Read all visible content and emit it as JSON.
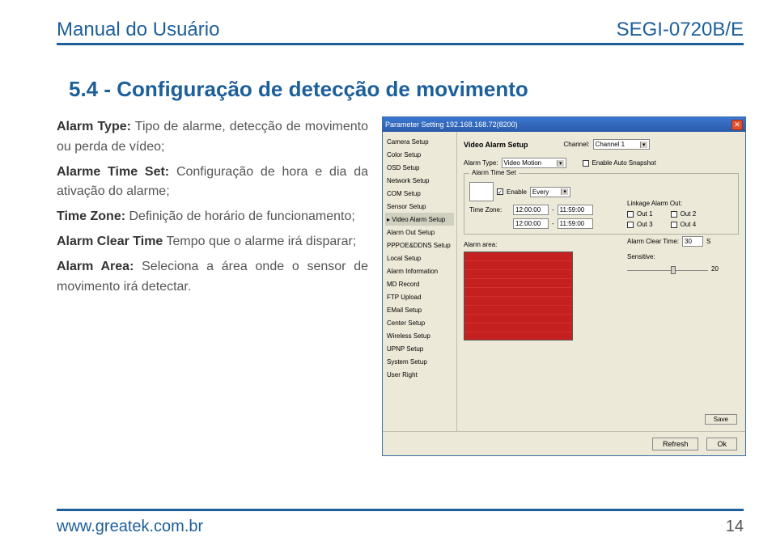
{
  "header": {
    "left": "Manual do Usuário",
    "right": "SEGI-0720B/E"
  },
  "section_title": "5.4 - Configuração de detecção de movimento",
  "paragraphs": {
    "p1_b": "Alarm Type:",
    "p1": " Tipo de alarme, detecção de movimento ou perda de vídeo;",
    "p2_b": "Alarme Time Set:",
    "p2": " Configuração de hora e dia da ativação do alarme;",
    "p3_b": "Time Zone:",
    "p3": " Definição de horário de funcionamento;",
    "p4_b": "Alarm Clear Time",
    "p4": " Tempo que o alarme irá disparar;",
    "p5_b": "Alarm Area:",
    "p5": " Seleciona a área onde o sensor de movimento irá detectar."
  },
  "footer": {
    "left": "www.greatek.com.br",
    "right": "14"
  },
  "win": {
    "title": "Parameter Setting 192.168.168.72(8200)",
    "sidebar": [
      "Camera Setup",
      "Color Setup",
      "OSD Setup",
      "Network Setup",
      "COM Setup",
      "Sensor Setup",
      "Video Alarm Setup",
      "Alarm Out Setup",
      "PPPOE&DDNS Setup",
      "Local Setup",
      "Alarm Information",
      "MD Record",
      "FTP Upload",
      "EMail Setup",
      "Center Setup",
      "Wireless Setup",
      "UPNP Setup",
      "System Setup",
      "User Right"
    ],
    "sidebar_selected": 6,
    "main_title": "Video Alarm Setup",
    "channel_label": "Channel:",
    "channel_value": "Channel 1",
    "alarm_type_label": "Alarm Type:",
    "alarm_type_value": "Video Motion",
    "auto_snap_label": "Enable Auto Snapshot",
    "timeset_legend": "Alarm Time Set",
    "enable_label": "Enable",
    "interval_value": "Every",
    "timezone_label": "Time Zone:",
    "tz_from": "12:00:00",
    "tz_to": "11:59:00",
    "tz2_from": "12:00:00",
    "tz2_to": "11:59:00",
    "alarm_area_label": "Alarm area:",
    "linkage_label": "Linkage Alarm Out:",
    "out1": "Out 1",
    "out2": "Out 2",
    "out3": "Out 3",
    "out4": "Out 4",
    "clear_label": "Alarm Clear Time:",
    "clear_value": "30",
    "clear_unit": "S",
    "sensitive_label": "Sensitive:",
    "sensitive_value": "20",
    "save": "Save",
    "refresh": "Refresh",
    "ok": "Ok"
  }
}
